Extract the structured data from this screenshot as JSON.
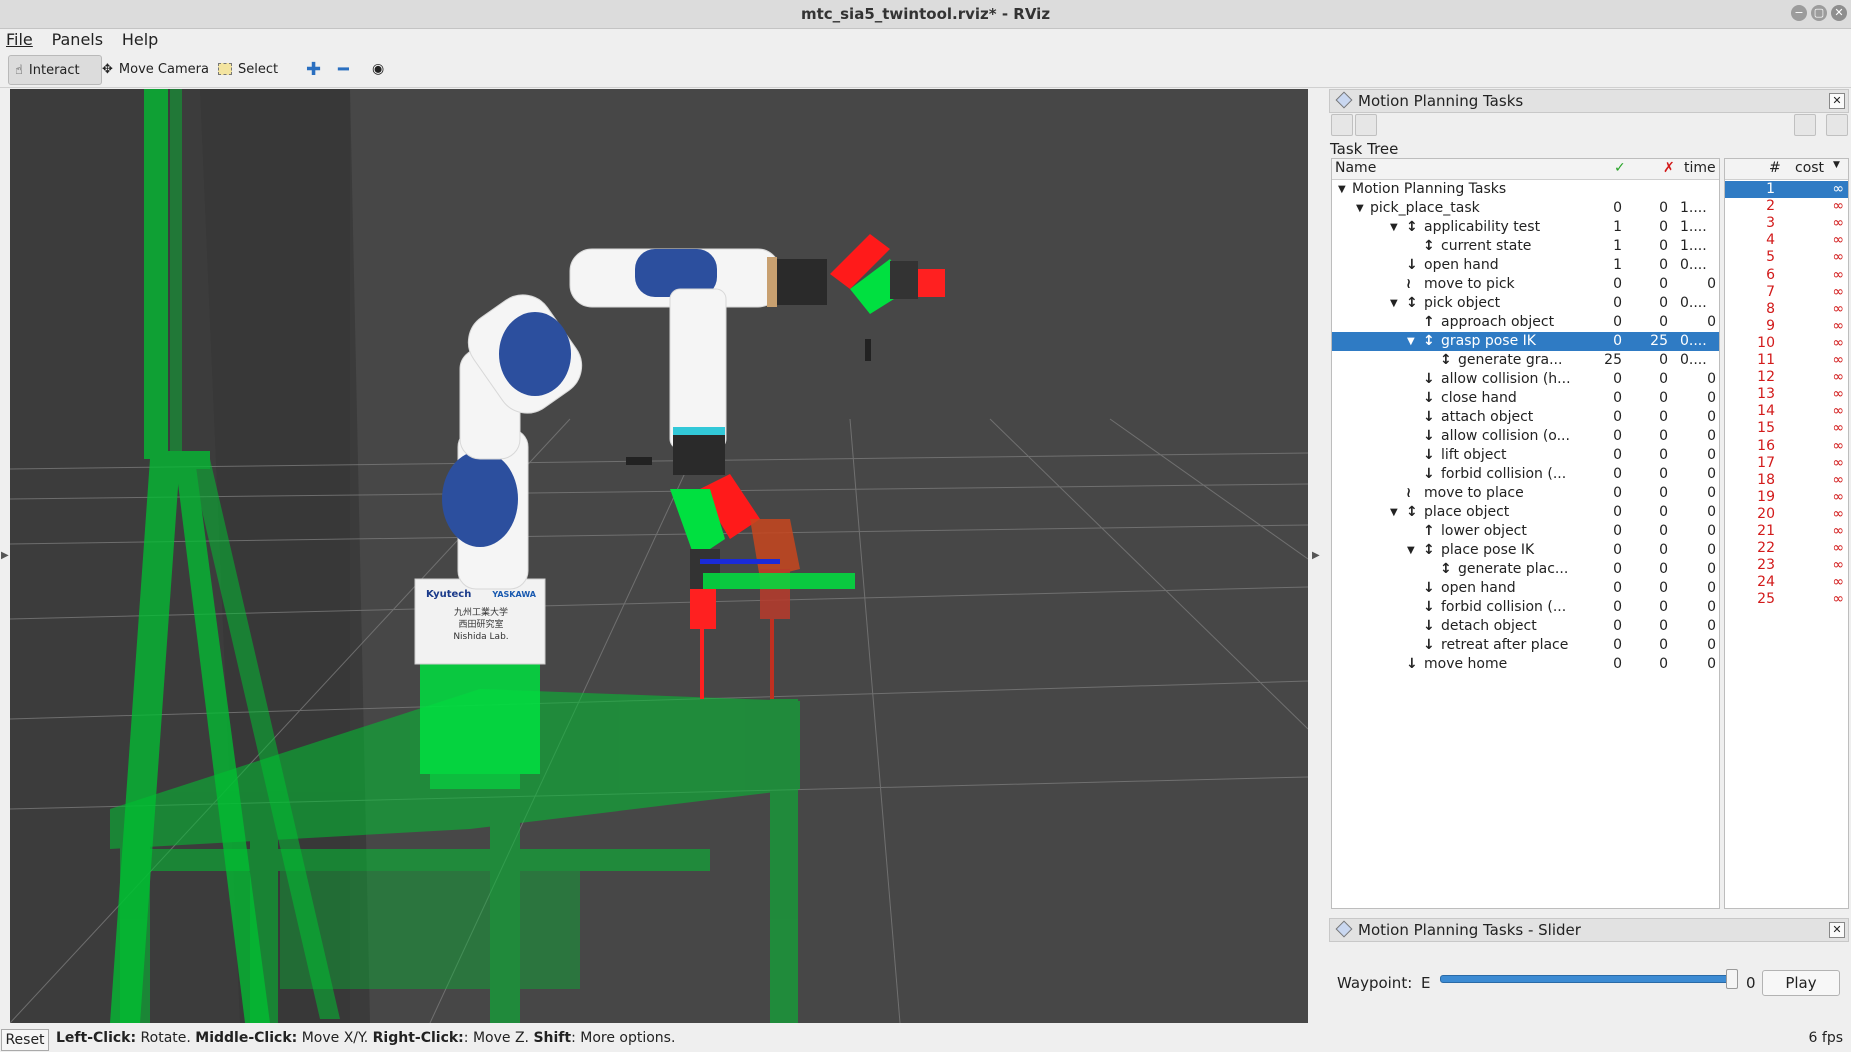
{
  "window": {
    "title": "mtc_sia5_twintool.rviz* - RViz"
  },
  "menu": [
    "File",
    "Panels",
    "Help"
  ],
  "toolbar": {
    "interact": "Interact",
    "move_camera": "Move Camera",
    "select": "Select"
  },
  "viewport": {
    "label_line1": "Kyutech",
    "label_line2": "YASKAWA",
    "label_line3": "九州工業大学",
    "label_line4": "西田研究室",
    "label_line5": "Nishida Lab."
  },
  "tasks_panel": {
    "title": "Motion Planning Tasks",
    "tree_label": "Task Tree",
    "columns": {
      "name": "Name",
      "ok": "✓",
      "fail": "✗",
      "time": "time"
    },
    "rows": [
      {
        "name": "Motion Planning Tasks",
        "ok": "",
        "fail": "",
        "time": ""
      },
      {
        "name": "pick_place_task",
        "ok": "0",
        "fail": "0",
        "time": "1...."
      },
      {
        "name": "applicability test",
        "ok": "1",
        "fail": "0",
        "time": "1...."
      },
      {
        "name": "current state",
        "ok": "1",
        "fail": "0",
        "time": "1...."
      },
      {
        "name": "open hand",
        "ok": "1",
        "fail": "0",
        "time": "0...."
      },
      {
        "name": "move to pick",
        "ok": "0",
        "fail": "0",
        "time": "0"
      },
      {
        "name": "pick object",
        "ok": "0",
        "fail": "0",
        "time": "0...."
      },
      {
        "name": "approach object",
        "ok": "0",
        "fail": "0",
        "time": "0"
      },
      {
        "name": "grasp pose IK",
        "ok": "0",
        "fail": "25",
        "time": "0...."
      },
      {
        "name": "generate gra...",
        "ok": "25",
        "fail": "0",
        "time": "0...."
      },
      {
        "name": "allow collision (h...",
        "ok": "0",
        "fail": "0",
        "time": "0"
      },
      {
        "name": "close hand",
        "ok": "0",
        "fail": "0",
        "time": "0"
      },
      {
        "name": "attach object",
        "ok": "0",
        "fail": "0",
        "time": "0"
      },
      {
        "name": "allow collision (o...",
        "ok": "0",
        "fail": "0",
        "time": "0"
      },
      {
        "name": "lift object",
        "ok": "0",
        "fail": "0",
        "time": "0"
      },
      {
        "name": "forbid collision (...",
        "ok": "0",
        "fail": "0",
        "time": "0"
      },
      {
        "name": "move to place",
        "ok": "0",
        "fail": "0",
        "time": "0"
      },
      {
        "name": "place object",
        "ok": "0",
        "fail": "0",
        "time": "0"
      },
      {
        "name": "lower object",
        "ok": "0",
        "fail": "0",
        "time": "0"
      },
      {
        "name": "place pose IK",
        "ok": "0",
        "fail": "0",
        "time": "0"
      },
      {
        "name": "generate plac...",
        "ok": "0",
        "fail": "0",
        "time": "0"
      },
      {
        "name": "open hand",
        "ok": "0",
        "fail": "0",
        "time": "0"
      },
      {
        "name": "forbid collision (...",
        "ok": "0",
        "fail": "0",
        "time": "0"
      },
      {
        "name": "detach object",
        "ok": "0",
        "fail": "0",
        "time": "0"
      },
      {
        "name": "retreat after place",
        "ok": "0",
        "fail": "0",
        "time": "0"
      },
      {
        "name": "move home",
        "ok": "0",
        "fail": "0",
        "time": "0"
      }
    ],
    "cost_columns": {
      "index": "#",
      "cost": "cost"
    },
    "solutions": [
      "1",
      "2",
      "3",
      "4",
      "5",
      "6",
      "7",
      "8",
      "9",
      "10",
      "11",
      "12",
      "13",
      "14",
      "15",
      "16",
      "17",
      "18",
      "19",
      "20",
      "21",
      "22",
      "23",
      "24",
      "25"
    ],
    "cost_value": "∞"
  },
  "slider_panel": {
    "title": "Motion Planning Tasks - Slider",
    "waypoint_label": "Waypoint:",
    "waypoint_left": "E",
    "waypoint_value": "0",
    "play": "Play"
  },
  "status": {
    "reset": "Reset",
    "lc": "Left-Click:",
    "lc_t": " Rotate. ",
    "mc": "Middle-Click:",
    "mc_t": " Move X/Y. ",
    "rc": "Right-Click:",
    "rc_t": ": Move Z. ",
    "sh": "Shift",
    "sh_t": ": More options.",
    "fps": "6 fps"
  },
  "colors": {
    "accent": "#2f7bc4",
    "cost": "#d21a1a",
    "viewport_bg": "#474747",
    "robot_blue": "#2c4f9e",
    "collision_green": "#00d23a"
  }
}
